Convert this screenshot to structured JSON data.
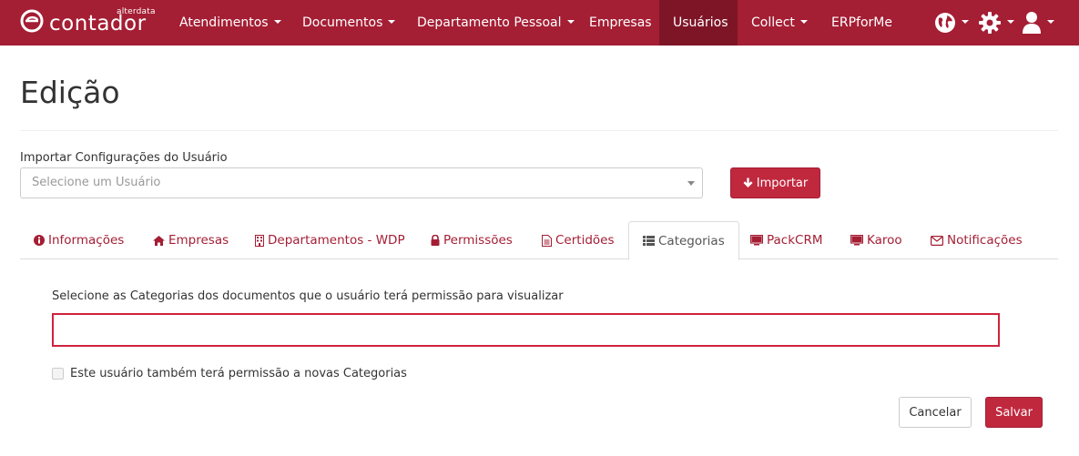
{
  "brand": {
    "name": "contador",
    "sub": "alterdata"
  },
  "nav": {
    "items": [
      {
        "label": "Atendimentos",
        "dropdown": true
      },
      {
        "label": "Documentos",
        "dropdown": true
      },
      {
        "label": "Departamento Pessoal",
        "dropdown": true
      },
      {
        "label": "Empresas",
        "dropdown": false
      },
      {
        "label": "Usuários",
        "dropdown": false,
        "active": true
      },
      {
        "label": "Collect",
        "dropdown": true
      },
      {
        "label": "ERPforMe",
        "dropdown": false
      }
    ],
    "icons": [
      "globe-icon",
      "gear-icon",
      "user-icon"
    ]
  },
  "page": {
    "title": "Edição"
  },
  "import": {
    "label": "Importar Configurações do Usuário",
    "placeholder": "Selecione um Usuário",
    "button_label": "Importar"
  },
  "tabs": [
    {
      "label": "Informações",
      "icon": "info-circle-icon"
    },
    {
      "label": "Empresas",
      "icon": "home-icon"
    },
    {
      "label": "Departamentos - WDP",
      "icon": "building-icon"
    },
    {
      "label": "Permissões",
      "icon": "lock-icon"
    },
    {
      "label": "Certidões",
      "icon": "document-icon"
    },
    {
      "label": "Categorias",
      "icon": "list-icon",
      "active": true
    },
    {
      "label": "PackCRM",
      "icon": "monitor-icon"
    },
    {
      "label": "Karoo",
      "icon": "monitor-icon"
    },
    {
      "label": "Notificações",
      "icon": "envelope-icon"
    }
  ],
  "categorias": {
    "label": "Selecione as Categorias dos documentos que o usuário terá permissão para visualizar",
    "value": "",
    "checkbox_label": "Este usuário também terá permissão a novas Categorias",
    "checked": false
  },
  "actions": {
    "cancel_label": "Cancelar",
    "save_label": "Salvar"
  },
  "colors": {
    "brand": "#a41e34",
    "brand_active": "#7e1527",
    "button": "#c0283e",
    "error_border": "#d0233c"
  }
}
